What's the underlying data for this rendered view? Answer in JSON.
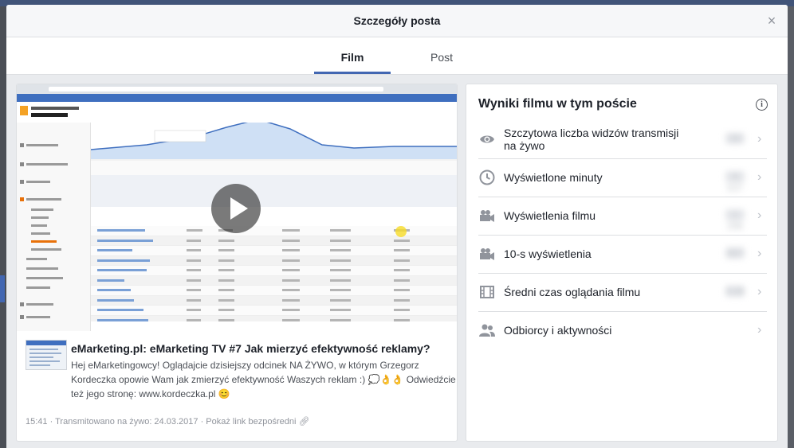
{
  "modal": {
    "title": "Szczegóły posta",
    "close_symbol": "×"
  },
  "tabs": [
    {
      "label": "Film",
      "active": true
    },
    {
      "label": "Post",
      "active": false
    }
  ],
  "post": {
    "title": "eMarketing.pl: eMarketing TV #7 Jak mierzyć efektywność reklamy?",
    "description": "Hej eMarketingowcy! Oglądajcie dzisiejszy odcinek NA ŻYWO, w którym Grzegorz Kordeczka opowie Wam jak zmierzyć efektywność Waszych reklam :) 💭👌👌 Odwiedźcie też jego stronę: www.kordeczka.pl 😊",
    "duration": "15:41",
    "broadcast": "Transmitowano na żywo: 24.03.2017",
    "separator": "·",
    "direct_link": "Pokaż link bezpośredni",
    "link_icon": "link-icon"
  },
  "stats": {
    "title": "Wyniki filmu w tym poście",
    "info_icon": "i",
    "accent_color": "#4267b2",
    "rows": [
      {
        "label": "Szczytowa liczba widzów transmisji na żywo",
        "icon": "eye-icon",
        "value": "23"
      },
      {
        "label": "Wyświetlone minuty",
        "icon": "clock-icon",
        "value": "4 537"
      },
      {
        "label": "Wyświetlenia filmu",
        "icon": "video-camera-icon",
        "value": "1 296"
      },
      {
        "label": "10-s wyświetlenia",
        "icon": "video-camera-icon",
        "value": "357"
      },
      {
        "label": "Średni czas oglądania filmu",
        "icon": "film-icon",
        "value": "3:28"
      },
      {
        "label": "Odbiorcy i aktywności",
        "icon": "people-icon",
        "value": ""
      }
    ],
    "chevron": "›"
  }
}
